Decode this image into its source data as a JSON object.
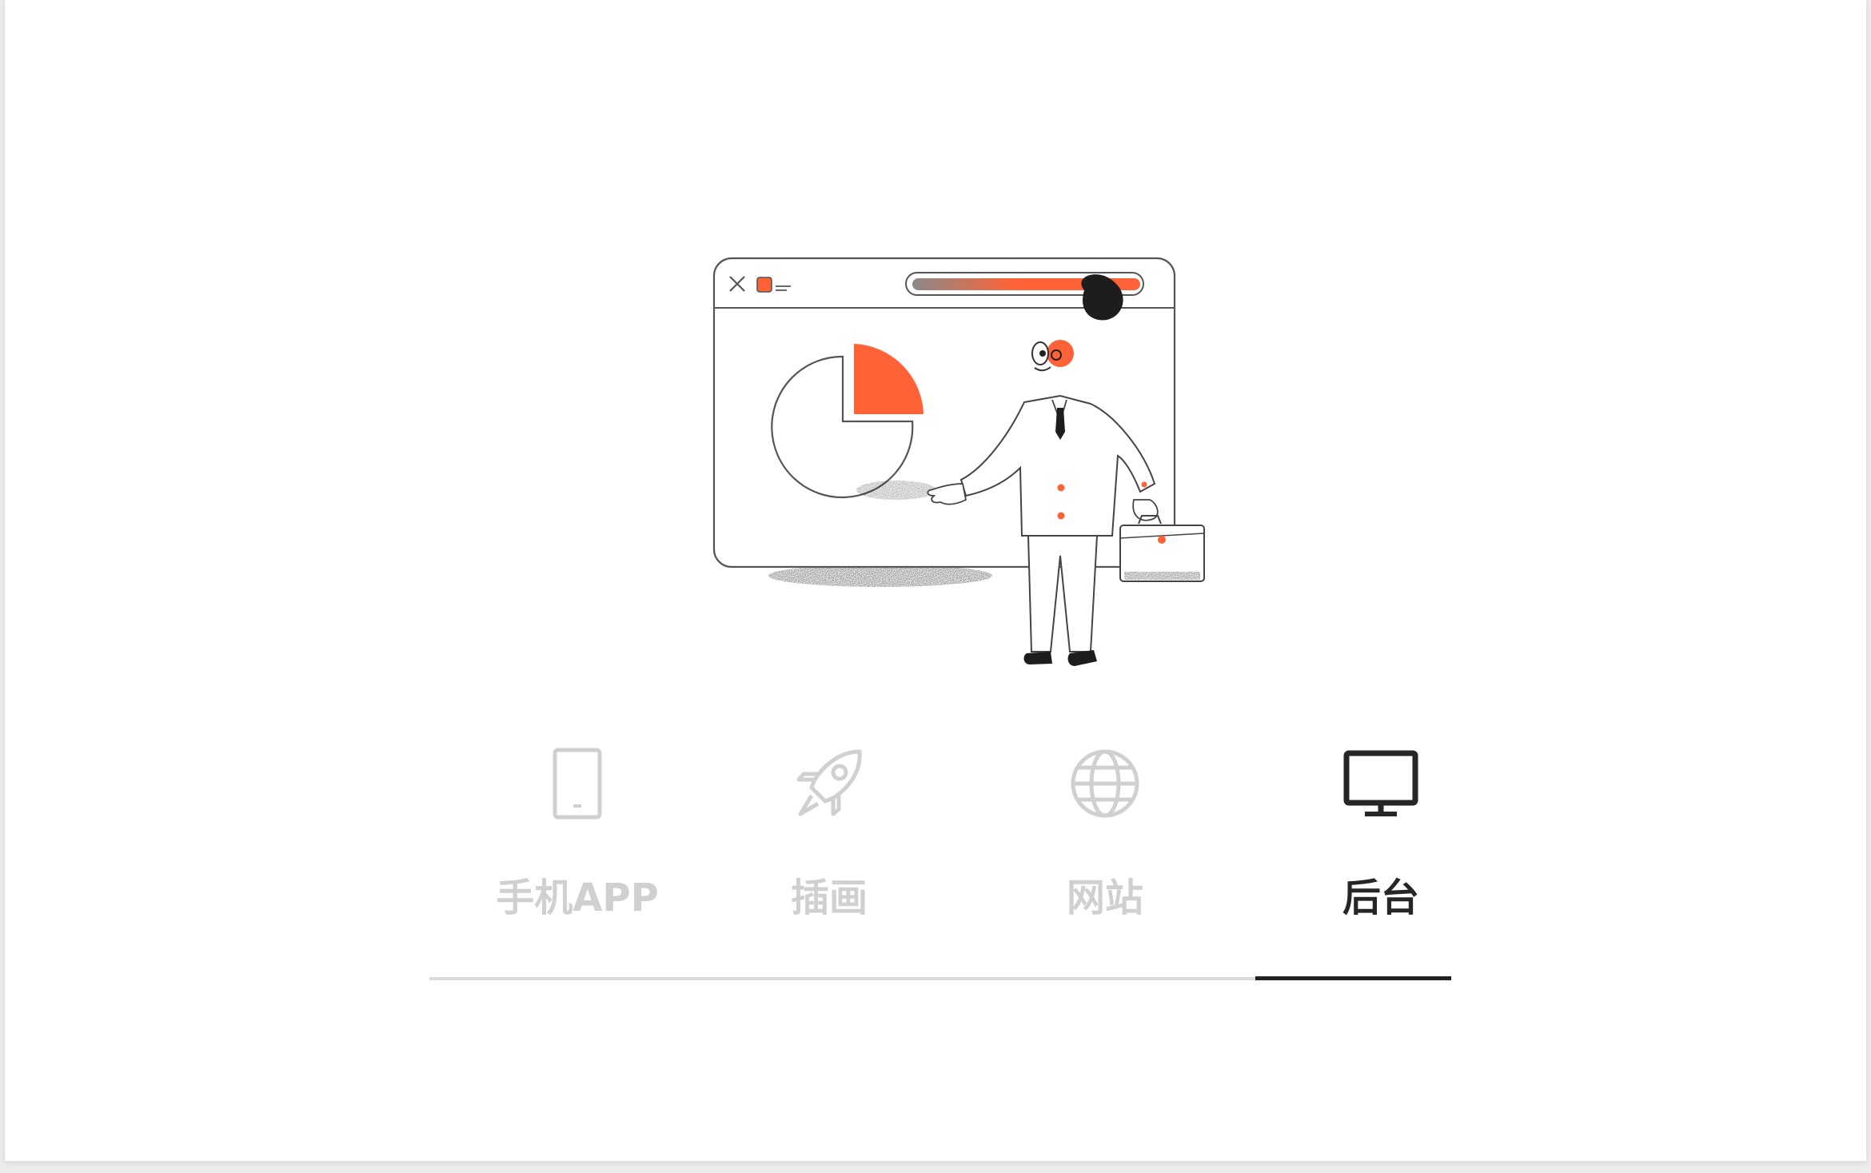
{
  "colors": {
    "accent": "#ff6236",
    "inactive": "#d0d0d0",
    "active": "#262626",
    "line": "#dcdcdc"
  },
  "tabs": [
    {
      "label": "手机APP",
      "icon": "mobile-phone-icon",
      "active": false
    },
    {
      "label": "插画",
      "icon": "rocket-icon",
      "active": false
    },
    {
      "label": "网站",
      "icon": "globe-icon",
      "active": false
    },
    {
      "label": "后台",
      "icon": "monitor-icon",
      "active": true
    }
  ]
}
